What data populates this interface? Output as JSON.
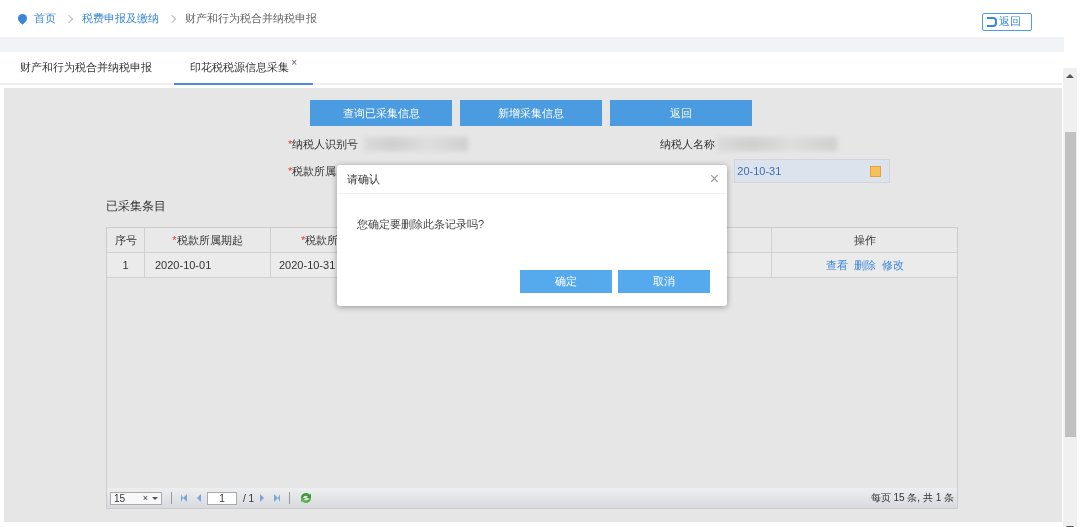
{
  "breadcrumb": [
    {
      "label": "首页",
      "kind": "link"
    },
    {
      "label": "税费申报及缴纳",
      "kind": "link"
    },
    {
      "label": "财产和行为税合并纳税申报",
      "kind": "current"
    }
  ],
  "back_button": {
    "label": "返回"
  },
  "tabs": [
    {
      "label": "财产和行为税合并纳税申报",
      "selected": false,
      "closable": false
    },
    {
      "label": "印花税税源信息采集",
      "selected": true,
      "closable": true,
      "close": "×"
    }
  ],
  "action_buttons": [
    "查询已采集信息",
    "新增采集信息",
    "返回"
  ],
  "form": {
    "taxpayer_id_label": "纳税人识别号",
    "taxpayer_name_label": "纳税人名称",
    "period_label": "税款所属",
    "period_end_value": "20-10-31",
    "required_mark": "*"
  },
  "section_title": "已采集条目",
  "table": {
    "columns": [
      {
        "label": "序号",
        "required": false
      },
      {
        "label": "税款所属期起",
        "required": true
      },
      {
        "label": "税款所",
        "required": true
      },
      {
        "label": "操作",
        "required": false
      }
    ],
    "rows": [
      {
        "cells": [
          "1",
          "2020-10-01",
          "2020-10-31"
        ],
        "actions": [
          "查看",
          "删除",
          "修改"
        ]
      }
    ]
  },
  "pager": {
    "page_size": "15",
    "clear": "×",
    "page": "1",
    "total_pages": "/ 1",
    "summary": "每页 15 条, 共 1 条"
  },
  "dialog": {
    "title": "请确认",
    "message": "您确定要删除此条记录吗?",
    "close": "×",
    "buttons": [
      "确定",
      "取消"
    ]
  }
}
